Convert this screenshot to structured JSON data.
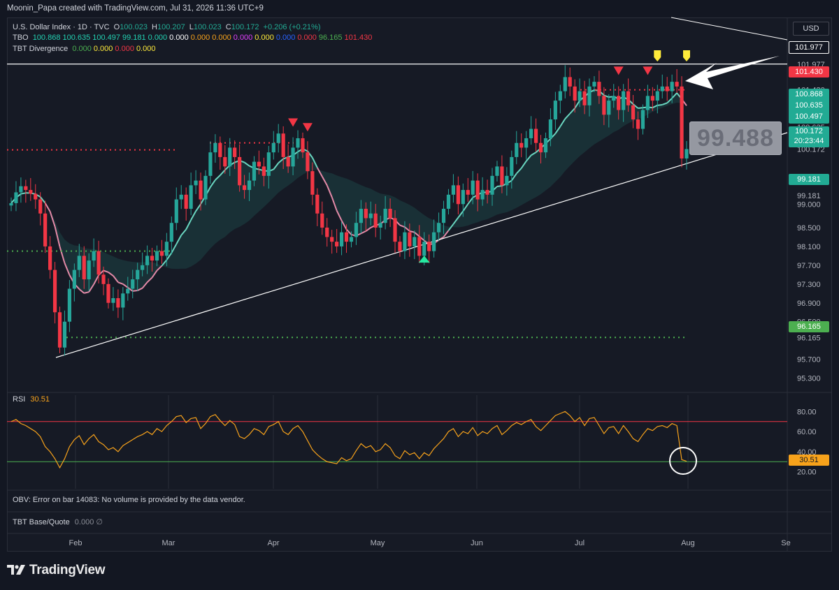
{
  "attribution": "Moonin_Papa created with TradingView.com, Jul 31, 2026 11:36 UTC+9",
  "legend": {
    "title": "U.S. Dollar Index · 1D · TVC",
    "ohlc": {
      "o_label": "O",
      "o": "100.023",
      "h_label": "H",
      "h": "100.207",
      "l_label": "L",
      "l": "100.023",
      "c_label": "C",
      "c": "100.172",
      "change": "+0.206 (+0.21%)"
    },
    "tbo_name": "TBO",
    "tbo_values": [
      "100.868",
      "100.635",
      "100.497",
      "99.181",
      "0.000",
      "0.000",
      "0.000",
      "0.000",
      "0.000",
      "0.000",
      "0.000",
      "0.000",
      "96.165",
      "101.430"
    ],
    "tbo_colors": [
      "#22d1b2",
      "#22d1b2",
      "#22d1b2",
      "#22d1b2",
      "#22d1b2",
      "#ffffff",
      "#f7a21b",
      "#f7a21b",
      "#e040fb",
      "#ffeb3b",
      "#2962ff",
      "#f23645",
      "#4caf50",
      "#f23645"
    ],
    "div_name": "TBT Divergence",
    "div_values": [
      "0.000",
      "0.000",
      "0.000",
      "0.000"
    ],
    "div_colors": [
      "#4caf50",
      "#ffeb3b",
      "#f23645",
      "#ffeb3b"
    ]
  },
  "currency_button": "USD",
  "price_axis": {
    "ticks": [
      "101.977",
      "101.430",
      "100.868",
      "100.635",
      "100.497",
      "100.172",
      "99.500",
      "99.181",
      "99.000",
      "98.500",
      "98.100",
      "97.700",
      "97.300",
      "96.900",
      "96.500",
      "96.165",
      "95.700",
      "95.300"
    ],
    "current_price": "100.172",
    "countdown": "20:23:44",
    "colors": {
      "resistance": "#ffffff",
      "red_level": "#f23645",
      "tbo_fast": "#22ab94",
      "current": "#22ab94",
      "support": "#4caf50",
      "plain": "#131722"
    }
  },
  "annotation_label": "99.488",
  "rsi": {
    "name": "RSI",
    "value": "30.51",
    "ticks": [
      "80.00",
      "60.00",
      "40.00",
      "20.00"
    ],
    "overbought": 70,
    "oversold": 30,
    "line_color": "#f7a21b"
  },
  "obv_text": "OBV: Error on bar 14083: No volume is provided by the data vendor.",
  "tbt_base_quote": {
    "name": "TBT Base/Quote",
    "value": "0.000",
    "symbol": "∅"
  },
  "time_axis": [
    "Feb",
    "Mar",
    "Apr",
    "May",
    "Jun",
    "Jul",
    "Aug",
    "Se"
  ],
  "logo_text": "TradingView",
  "chart_data": {
    "type": "candlestick",
    "title": "U.S. Dollar Index · 1D · TVC",
    "y_range": [
      95.1,
      102.3
    ],
    "x": [
      "Jan 8",
      "Jan 9",
      "Jan 12",
      "Jan 13",
      "Jan 14",
      "Jan 15",
      "Jan 16",
      "Jan 19",
      "Jan 20",
      "Jan 21",
      "Jan 22",
      "Jan 23",
      "Jan 26",
      "Jan 27",
      "Jan 28",
      "Jan 29",
      "Jan 30",
      "Feb 2",
      "Feb 3",
      "Feb 4",
      "Feb 5",
      "Feb 6",
      "Feb 9",
      "Feb 10",
      "Feb 11",
      "Feb 12",
      "Feb 13",
      "Feb 16",
      "Feb 17",
      "Feb 18",
      "Feb 19",
      "Feb 20",
      "Feb 23",
      "Feb 24",
      "Feb 25",
      "Feb 26",
      "Feb 27",
      "Mar 2",
      "Mar 3",
      "Mar 4",
      "Mar 5",
      "Mar 6",
      "Mar 9",
      "Mar 10",
      "Mar 11",
      "Mar 12",
      "Mar 13",
      "Mar 16",
      "Mar 17",
      "Mar 18",
      "Mar 19",
      "Mar 20",
      "Mar 23",
      "Mar 24",
      "Mar 25",
      "Mar 26",
      "Mar 27",
      "Mar 30",
      "Mar 31",
      "Apr 1",
      "Apr 2",
      "Apr 3",
      "Apr 6",
      "Apr 7",
      "Apr 8",
      "Apr 9",
      "Apr 10",
      "Apr 13",
      "Apr 14",
      "Apr 15",
      "Apr 16",
      "Apr 17",
      "Apr 20",
      "Apr 21",
      "Apr 22",
      "Apr 23",
      "Apr 24",
      "Apr 27",
      "Apr 28",
      "Apr 29",
      "Apr 30",
      "May 1",
      "May 4",
      "May 5",
      "May 6",
      "May 7",
      "May 8",
      "May 11",
      "May 12",
      "May 13",
      "May 14",
      "May 15",
      "May 18",
      "May 19",
      "May 20",
      "May 21",
      "May 22",
      "May 25",
      "May 26",
      "May 27",
      "May 28",
      "May 29",
      "Jun 1",
      "Jun 2",
      "Jun 3",
      "Jun 4",
      "Jun 5",
      "Jun 8",
      "Jun 9",
      "Jun 10",
      "Jun 11",
      "Jun 12",
      "Jun 15",
      "Jun 16",
      "Jun 17",
      "Jun 18",
      "Jun 19",
      "Jun 22",
      "Jun 23",
      "Jun 24",
      "Jun 25",
      "Jun 26",
      "Jun 29",
      "Jun 30",
      "Jul 1",
      "Jul 2",
      "Jul 3",
      "Jul 6",
      "Jul 7",
      "Jul 8",
      "Jul 9",
      "Jul 10",
      "Jul 13",
      "Jul 14",
      "Jul 15",
      "Jul 16",
      "Jul 17",
      "Jul 20",
      "Jul 21",
      "Jul 22",
      "Jul 23",
      "Jul 24",
      "Jul 27",
      "Jul 28",
      "Jul 29",
      "Jul 30",
      "Jul 31"
    ],
    "close": [
      99.02,
      99.25,
      99.38,
      99.3,
      99.22,
      99.1,
      98.8,
      98.1,
      97.6,
      96.7,
      95.95,
      96.5,
      97.2,
      97.6,
      97.9,
      97.4,
      97.8,
      98.0,
      97.5,
      97.3,
      96.9,
      97.0,
      96.8,
      97.1,
      97.2,
      97.4,
      97.6,
      97.7,
      97.9,
      97.8,
      98.0,
      97.9,
      98.2,
      98.6,
      99.1,
      99.2,
      98.9,
      99.4,
      99.5,
      99.1,
      99.6,
      100.1,
      100.3,
      100.0,
      99.8,
      100.2,
      100.0,
      99.4,
      99.3,
      99.5,
      99.9,
      99.8,
      99.6,
      100.1,
      100.3,
      100.5,
      100.0,
      99.8,
      100.2,
      100.4,
      100.1,
      99.7,
      99.2,
      98.8,
      98.5,
      98.3,
      98.2,
      98.1,
      98.4,
      98.2,
      98.3,
      98.6,
      98.9,
      98.7,
      98.8,
      98.5,
      98.6,
      98.9,
      98.7,
      98.2,
      98.0,
      98.4,
      98.1,
      98.3,
      97.9,
      98.2,
      98.0,
      98.4,
      98.6,
      98.9,
      99.2,
      99.4,
      99.0,
      99.3,
      99.2,
      99.5,
      99.1,
      99.3,
      99.2,
      99.6,
      99.8,
      99.4,
      99.6,
      100.0,
      100.3,
      100.2,
      100.4,
      100.6,
      100.3,
      100.1,
      100.4,
      100.8,
      101.2,
      101.4,
      101.7,
      101.5,
      101.2,
      101.4,
      101.1,
      101.5,
      101.6,
      101.3,
      100.9,
      101.2,
      101.3,
      101.0,
      101.4,
      101.1,
      100.8,
      100.6,
      101.0,
      101.3,
      101.2,
      101.4,
      101.5,
      101.4,
      101.6,
      101.5,
      99.97,
      100.17
    ],
    "rsi_series": [
      70,
      72,
      68,
      66,
      63,
      60,
      55,
      45,
      40,
      33,
      24,
      33,
      45,
      52,
      56,
      47,
      53,
      57,
      50,
      47,
      42,
      44,
      40,
      46,
      49,
      52,
      55,
      57,
      60,
      57,
      63,
      60,
      66,
      70,
      75,
      76,
      69,
      73,
      74,
      63,
      68,
      75,
      77,
      71,
      66,
      71,
      67,
      55,
      53,
      57,
      63,
      61,
      57,
      65,
      67,
      70,
      60,
      57,
      63,
      66,
      60,
      51,
      42,
      37,
      33,
      30,
      29,
      28,
      34,
      31,
      33,
      41,
      48,
      44,
      46,
      40,
      42,
      48,
      44,
      36,
      33,
      41,
      37,
      39,
      33,
      39,
      36,
      43,
      48,
      53,
      60,
      63,
      55,
      60,
      58,
      64,
      56,
      60,
      58,
      63,
      66,
      57,
      61,
      66,
      69,
      67,
      70,
      72,
      65,
      61,
      66,
      71,
      76,
      78,
      80,
      76,
      70,
      74,
      66,
      73,
      74,
      66,
      58,
      64,
      65,
      58,
      66,
      60,
      53,
      50,
      57,
      63,
      61,
      65,
      66,
      64,
      68,
      66,
      32,
      30.51
    ],
    "levels": {
      "resistance": 101.977,
      "red_dotted": 101.43,
      "green_dotted_mid": 98.0,
      "support": 96.165
    },
    "markers": [
      {
        "type": "down-arrow",
        "date": "Mar 31",
        "color": "#f23645"
      },
      {
        "type": "down-arrow",
        "date": "Apr 3",
        "color": "#f23645"
      },
      {
        "type": "down-arrow",
        "date": "Jul 2",
        "color": "#f23645"
      },
      {
        "type": "down-arrow",
        "date": "Jul 10",
        "color": "#f23645"
      },
      {
        "type": "flag",
        "date": "Jul 14",
        "color": "#ffeb3b"
      },
      {
        "type": "flag",
        "date": "Jul 22",
        "color": "#ffeb3b"
      },
      {
        "type": "up-arrow",
        "date": "May 7",
        "color": "#26e8a0"
      }
    ],
    "xlabel": "",
    "ylabel": ""
  }
}
